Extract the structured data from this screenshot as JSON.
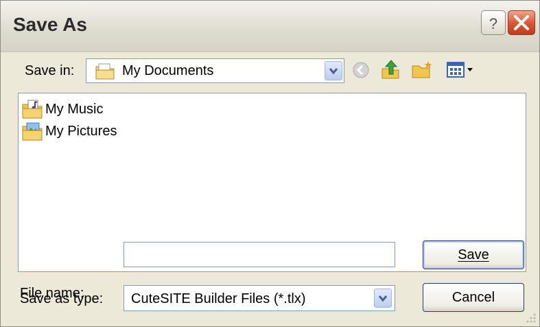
{
  "window": {
    "title": "Save As"
  },
  "toolbar": {
    "save_in_label": "Save in:",
    "location": "My Documents",
    "icons": [
      "back-icon",
      "up-folder-icon",
      "new-folder-icon",
      "views-menu-icon"
    ]
  },
  "files": [
    {
      "name": "My Music",
      "icon": "music-folder-icon"
    },
    {
      "name": "My Pictures",
      "icon": "pictures-folder-icon"
    }
  ],
  "form": {
    "file_name_label": "File name:",
    "file_name_value": "",
    "save_as_type_label": "Save as type:",
    "save_as_type_value": "CuteSITE Builder Files (*.tlx)"
  },
  "buttons": {
    "save": "Save",
    "cancel": "Cancel"
  },
  "colors": {
    "close_button": "#d8552f",
    "selection_border": "#7f9db9",
    "dialog_bg": "#ece9d8"
  }
}
